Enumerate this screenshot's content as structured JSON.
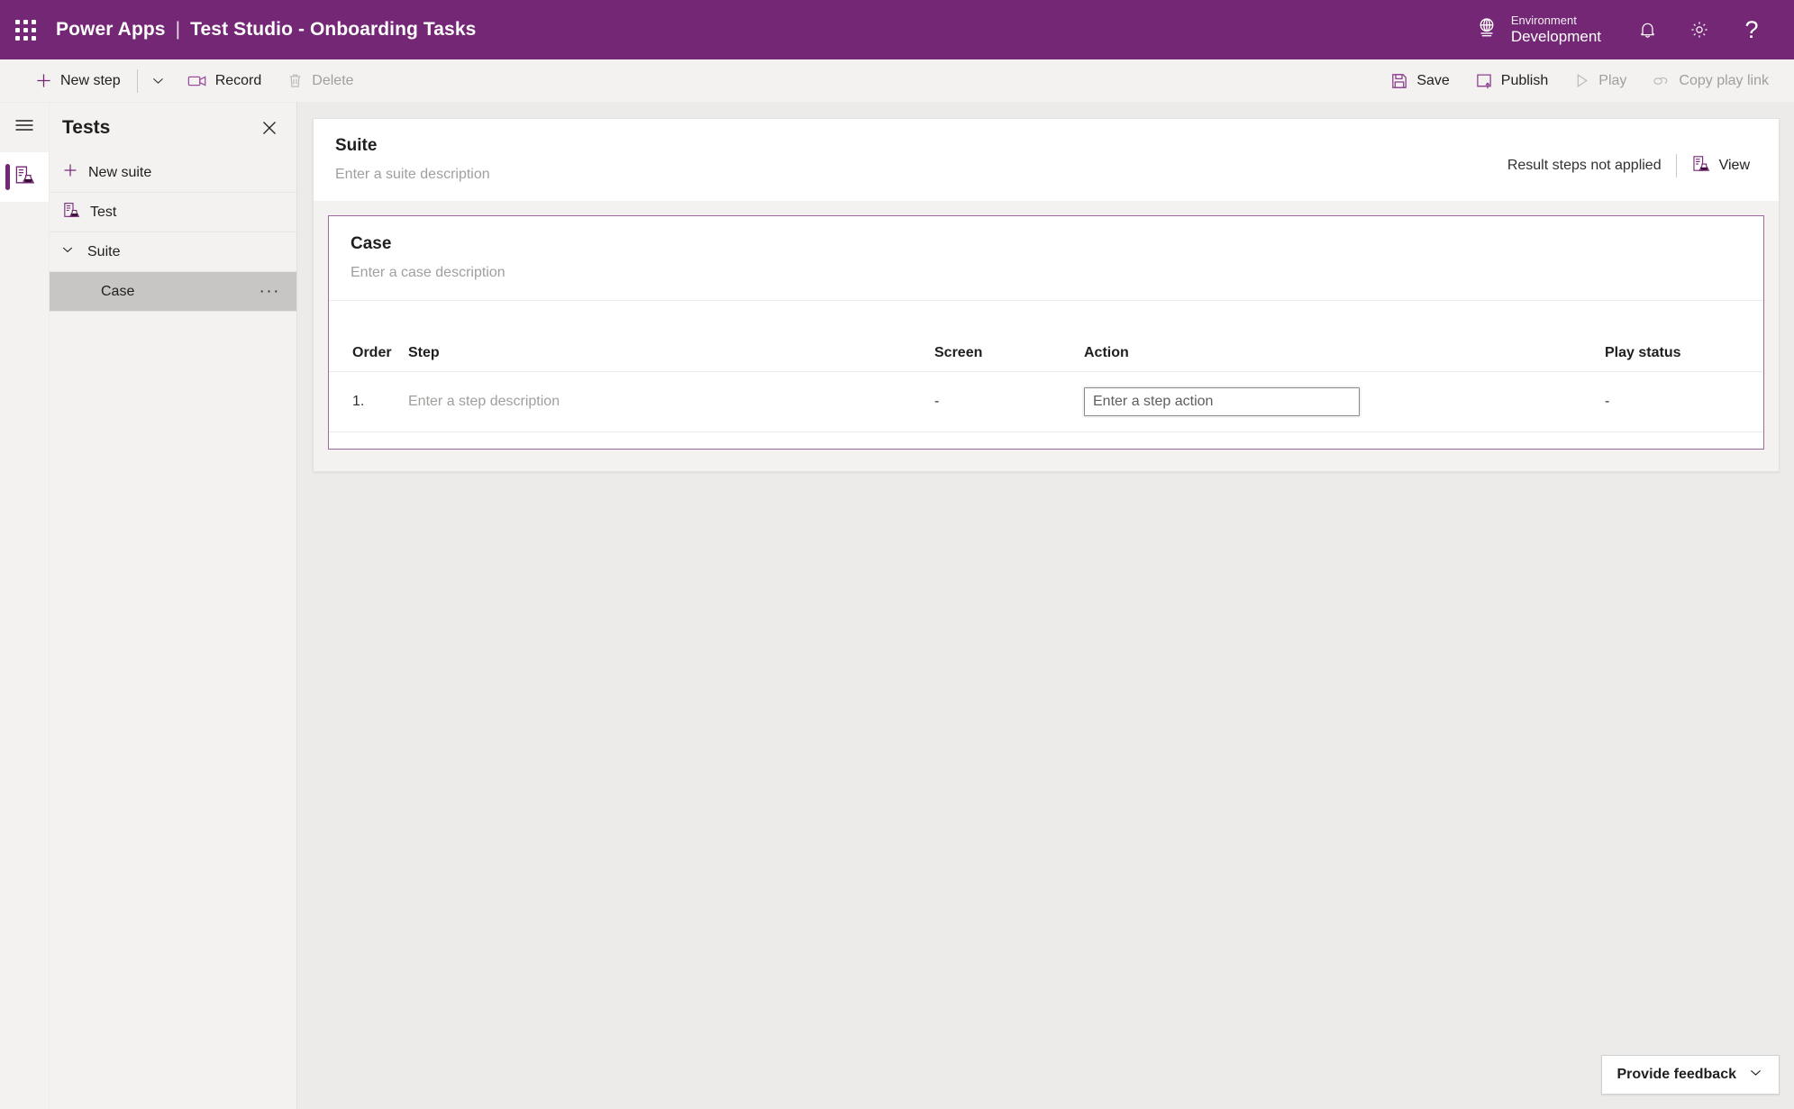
{
  "topbar": {
    "waffle_label": "App launcher",
    "brand": "Power Apps",
    "separator": "|",
    "app_title": "Test Studio - Onboarding Tasks",
    "environment_label": "Environment",
    "environment_value": "Development",
    "notifications_label": "Notifications",
    "settings_label": "Settings",
    "help_label": "?",
    "background_color": "#742774",
    "text_color": "#ffffff"
  },
  "commandbar": {
    "new_step": "New step",
    "new_step_chevron": "chevron-down",
    "record": "Record",
    "delete": "Delete",
    "save": "Save",
    "publish": "Publish",
    "play": "Play",
    "copy_play_link": "Copy play link",
    "accent_color": "#742774",
    "disabled_color": "#a19f9d"
  },
  "rail": {
    "hamburger_label": "Menu",
    "tests_label": "Tests",
    "active_indicator_color": "#742774"
  },
  "tests_panel": {
    "title": "Tests",
    "close_label": "Close",
    "new_suite": "New suite",
    "items": [
      {
        "label": "Test",
        "icon": "test-icon",
        "type": "test",
        "selected": false
      },
      {
        "label": "Suite",
        "icon": "chevron-down-icon",
        "type": "suite",
        "expanded": true,
        "selected": false
      },
      {
        "label": "Case",
        "icon": "",
        "type": "case",
        "selected": true,
        "overflow": "···"
      }
    ],
    "selected_row_color": "#c8c6c4"
  },
  "suite": {
    "name": "Suite",
    "description_placeholder": "Enter a suite description",
    "result_status": "Result steps not applied",
    "view_label": "View"
  },
  "case": {
    "name": "Case",
    "description_placeholder": "Enter a case description",
    "border_color": "#9a6b9a",
    "table": {
      "columns": [
        "Order",
        "Step",
        "Screen",
        "Action",
        "Play status"
      ],
      "rows": [
        {
          "order": "1.",
          "step_placeholder": "Enter a step description",
          "screen": "-",
          "action_placeholder": "Enter a step action",
          "action_value": "",
          "play_status": "-"
        }
      ]
    }
  },
  "feedback": {
    "label": "Provide feedback",
    "chevron": "chevron-down"
  }
}
